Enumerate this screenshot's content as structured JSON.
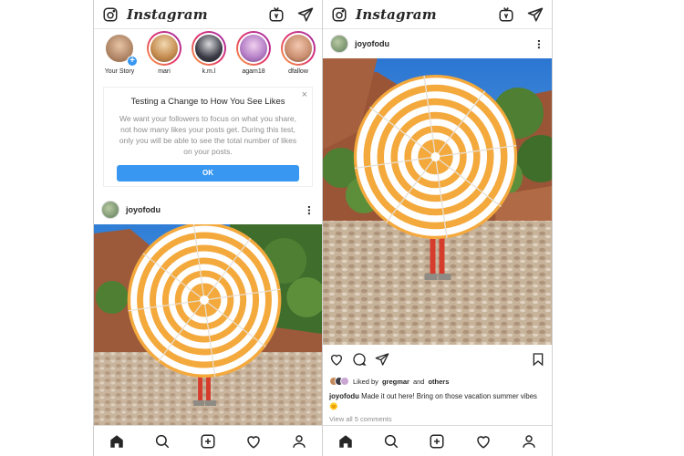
{
  "app": {
    "logo_text": "Instagram"
  },
  "icons": {
    "camera": "camera-icon",
    "igtv": "igtv-icon",
    "direct": "direct-message-icon",
    "home": "home-icon",
    "search": "search-icon",
    "add": "add-post-icon",
    "activity": "heart-icon",
    "profile": "profile-icon",
    "like": "heart-icon",
    "comment": "comment-icon",
    "share": "share-icon",
    "save": "bookmark-icon"
  },
  "colors": {
    "accent": "#3897f0",
    "story_ring_start": "#f9a33b",
    "story_ring_end": "#9b2fae",
    "umbrella_stripe": "#f4a93d"
  },
  "stories": [
    {
      "name": "Your Story",
      "color": "#c58a5b"
    },
    {
      "name": "mari",
      "color": "#d8a468"
    },
    {
      "name": "k.m.l",
      "color": "#3b3b46"
    },
    {
      "name": "agam18",
      "color": "#cba7d3"
    },
    {
      "name": "dfallow",
      "color": "#c98d6e"
    }
  ],
  "notice": {
    "close": "×",
    "title": "Testing a Change to How You See Likes",
    "body": "We want your followers to focus on what you share, not how many likes your posts get. During this test, only you will be able to see the total number of likes on your posts.",
    "ok_label": "OK"
  },
  "post": {
    "username": "joyofodu",
    "liked_prefix": "Liked by",
    "liked_user": "gregmar",
    "liked_and": "and",
    "liked_others": "others",
    "caption_user": "joyofodu",
    "caption_text": "Made it out here! Bring on those vacation summer vibes 🌞",
    "view_all": "View all 5 comments",
    "more": "···"
  }
}
